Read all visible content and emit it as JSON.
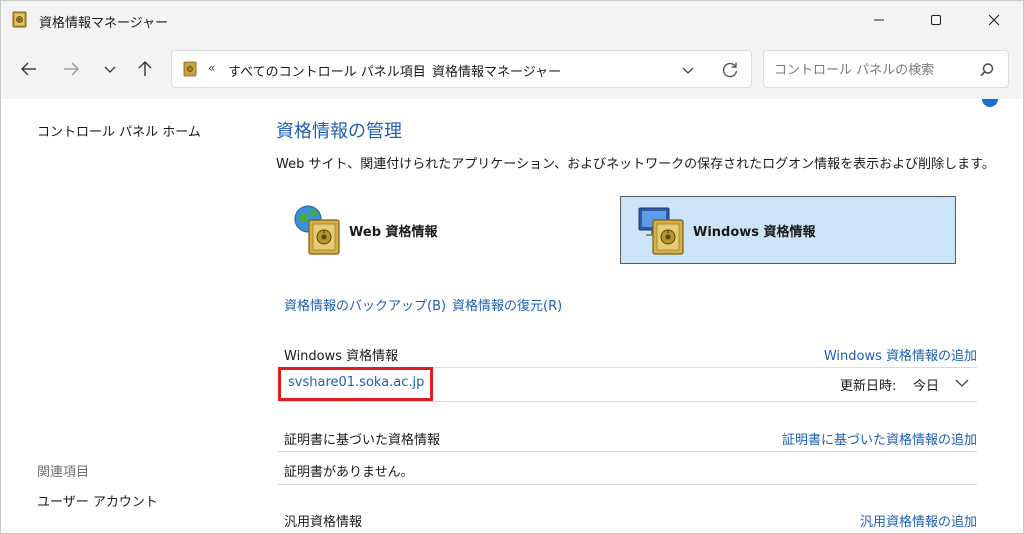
{
  "window": {
    "title": "資格情報マネージャー"
  },
  "nav": {
    "address_chevrons": "«",
    "breadcrumb_root": "すべてのコントロール パネル項目",
    "breadcrumb_sep": "›",
    "breadcrumb_current": "資格情報マネージャー",
    "search_placeholder": "コントロール パネルの検索"
  },
  "sidebar": {
    "home": "コントロール パネル ホーム",
    "related_heading": "関連項目",
    "related_user": "ユーザー アカウント"
  },
  "main": {
    "title": "資格情報の管理",
    "description": "Web サイト、関連付けられたアプリケーション、およびネットワークの保存されたログオン情報を表示および削除します。",
    "tiles": {
      "web_label": "Web 資格情報",
      "windows_label": "Windows 資格情報"
    },
    "links": {
      "backup": "資格情報のバックアップ(B)",
      "restore": "資格情報の復元(R)"
    },
    "windows_section": {
      "title": "Windows 資格情報",
      "add": "Windows 資格情報の追加",
      "entries": [
        {
          "name": "svshare01.soka.ac.jp",
          "modified_label": "更新日時:",
          "modified_value": "今日"
        }
      ]
    },
    "cert_section": {
      "title": "証明書に基づいた資格情報",
      "add": "証明書に基づいた資格情報の追加",
      "empty": "証明書がありません。"
    },
    "generic_section": {
      "title": "汎用資格情報",
      "add": "汎用資格情報の追加"
    }
  },
  "colors": {
    "link": "#1e5fb4",
    "selected_tile_bg": "#cce4f7",
    "highlight_border": "#e01b24"
  }
}
